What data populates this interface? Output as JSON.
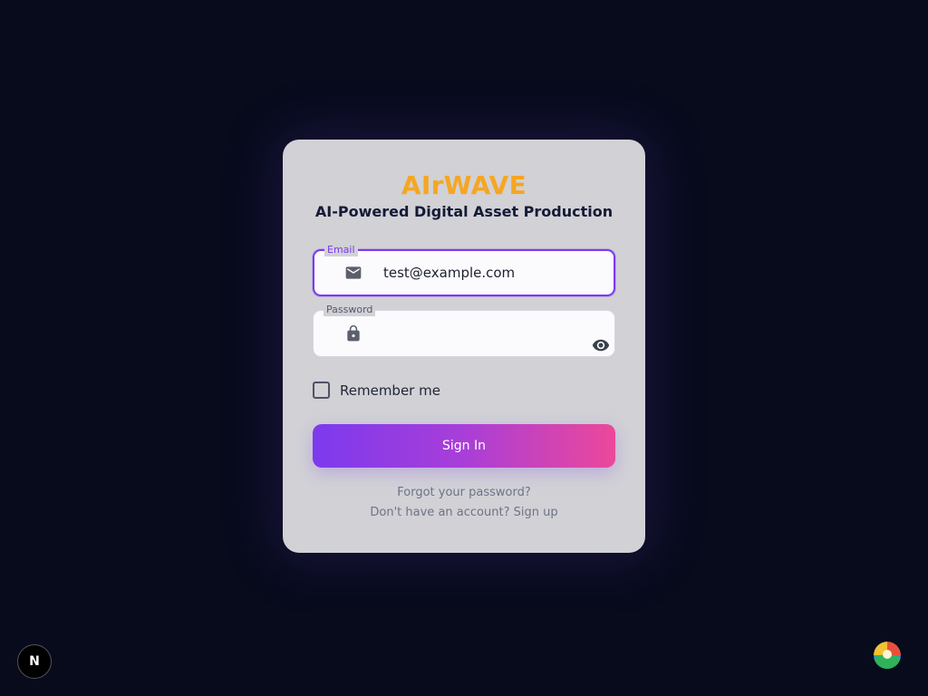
{
  "brand": {
    "name": "AIrWAVE",
    "tagline": "AI-Powered Digital Asset Production"
  },
  "form": {
    "email": {
      "label": "Email",
      "value": "test@example.com",
      "icon": "mail-icon"
    },
    "password": {
      "label": "Password",
      "value": "",
      "icon": "lock-icon",
      "toggle_icon": "eye-icon"
    },
    "remember_me": {
      "label": "Remember me",
      "checked": false
    },
    "submit_label": "Sign In",
    "forgot_link": "Forgot your password?",
    "signup_link": "Don't have an account? Sign up"
  },
  "badges": {
    "next": "N"
  },
  "colors": {
    "background": "#070b1c",
    "card": "#d1d1d6",
    "brand": "#f5a623",
    "accent": "#7c3aed",
    "accent_end": "#ec4899"
  }
}
